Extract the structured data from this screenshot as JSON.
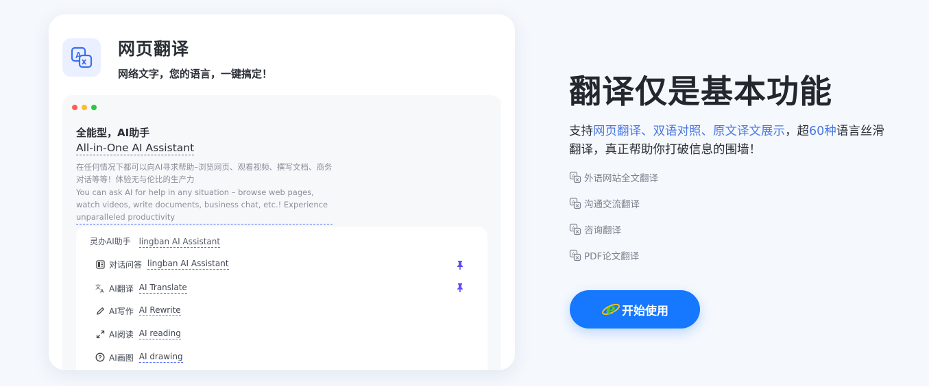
{
  "card": {
    "title": "网页翻译",
    "subtitle": "网络文字，您的语言，一键搞定！",
    "browser": {
      "heading_cn": "全能型，AI助手",
      "heading_en": "All-in-One AI Assistant",
      "desc_cn": "在任何情况下都可以向AI寻求帮助–浏览网页、观看视频、撰写文档、商务对话等等！体验无与伦比的生产力",
      "desc_en": "You can ask AI for help in any situation – browse web pages, watch videos, write documents, business chat, etc.! Experience unparalleled productivity",
      "panel": {
        "head_cn": "灵办AI助手",
        "head_en": "lingban AI Assistant",
        "items": [
          {
            "cn": "对话问答",
            "en": "lingban AI Assistant",
            "icon": "chat-icon",
            "pinned": true
          },
          {
            "cn": "AI翻译",
            "en": "AI Translate",
            "icon": "translate-icon",
            "pinned": true
          },
          {
            "cn": "AI写作",
            "en": "AI Rewrite",
            "icon": "pencil-icon",
            "pinned": false
          },
          {
            "cn": "AI阅读",
            "en": "AI reading",
            "icon": "expand-icon",
            "pinned": false
          },
          {
            "cn": "AI画图",
            "en": "AI drawing",
            "icon": "help-circle-icon",
            "pinned": false
          }
        ]
      }
    }
  },
  "hero": {
    "headline": "翻译仅是基本功能",
    "desc_prefix": "支持",
    "desc_highlight1": "网页翻译、双语对照、原文译文展示",
    "desc_middle": "，超",
    "desc_highlight2": "60种",
    "desc_suffix": "语言丝滑翻译，真正帮助你打破信息的围墙！",
    "features": [
      "外语网站全文翻译",
      "沟通交流翻译",
      "咨询翻译",
      "PDF论文翻译"
    ],
    "cta_label": "开始使用"
  },
  "colors": {
    "accent": "#1677ff",
    "highlight": "#4a78e0",
    "background": "#f5f8fd",
    "pin": "#5b4cf5"
  }
}
